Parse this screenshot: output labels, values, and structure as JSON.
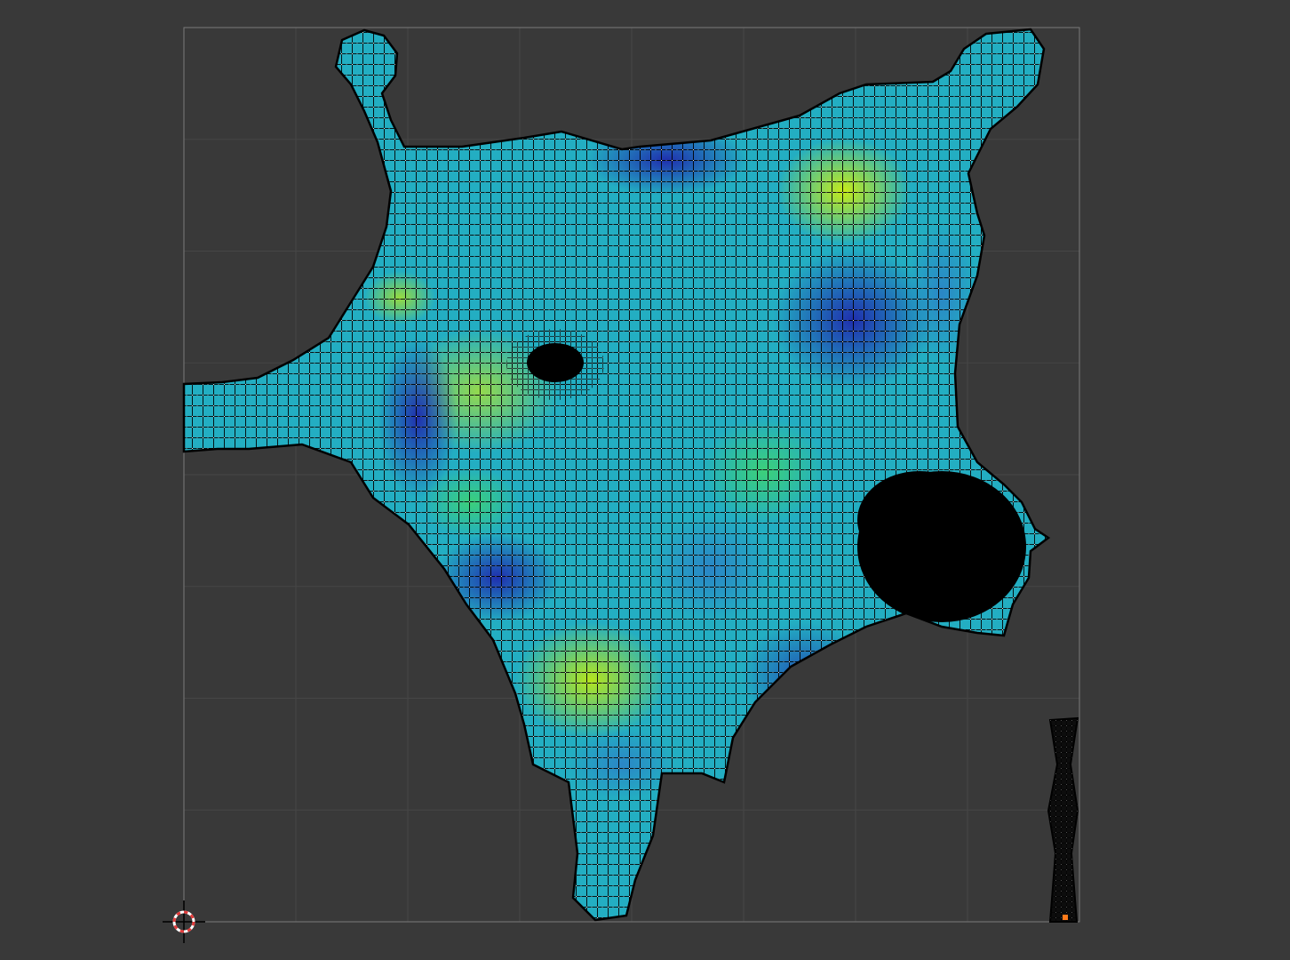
{
  "editor": {
    "background_color": "#393939",
    "grid_line_color": "#464646",
    "bounds_color": "#7a7a7a",
    "grid_divisions": 8
  },
  "stretch_colormap": {
    "low": "#1d2fa8",
    "mid_low": "#2f7fc4",
    "mid": "#23b3c3",
    "mid_high": "#35c98d",
    "high": "#b8e51d"
  },
  "mesh": {
    "edge_color": "#000000",
    "vertex_color": "#ffffff",
    "dense_region_color": "#000000"
  },
  "cursor": {
    "icon": "2d-cursor-icon",
    "ring_color_a": "#e23b3b",
    "ring_color_b": "#ffffff"
  },
  "selected_vertex": {
    "color": "#ff7a1a"
  }
}
